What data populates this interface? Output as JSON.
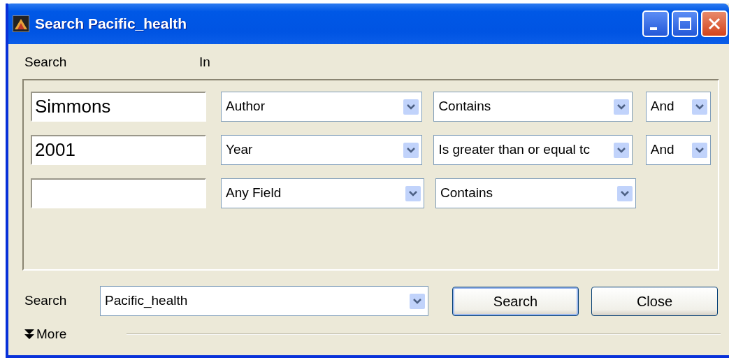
{
  "window": {
    "title": "Search Pacific_health"
  },
  "labels": {
    "search": "Search",
    "in": "In"
  },
  "rows": [
    {
      "value": "Simmons",
      "field": "Author",
      "operator": "Contains",
      "conjunction": "And"
    },
    {
      "value": "2001",
      "field": "Year",
      "operator": "Is greater than or equal tc",
      "conjunction": "And"
    },
    {
      "value": "",
      "field": "Any Field",
      "operator": "Contains"
    }
  ],
  "footer": {
    "label": "Search",
    "source": "Pacific_health",
    "buttons": [
      {
        "label": "Search",
        "kind": "default"
      },
      {
        "label": "Close",
        "kind": "normal"
      }
    ],
    "more": "More"
  }
}
